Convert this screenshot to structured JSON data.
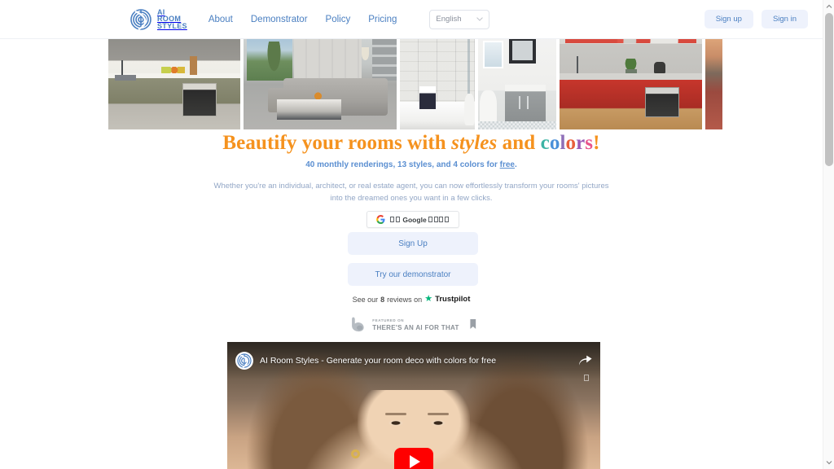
{
  "header": {
    "logo": {
      "icon": "spiral-logo-icon",
      "line1": "AI",
      "line2": "ROOM",
      "line3": "STYLES"
    },
    "nav": [
      {
        "label": "About"
      },
      {
        "label": "Demonstrator"
      },
      {
        "label": "Policy"
      },
      {
        "label": "Pricing"
      }
    ],
    "language": {
      "selected": "English",
      "icon": "chevron-down-icon"
    },
    "signup_label": "Sign up",
    "signin_label": "Sign in"
  },
  "hero": {
    "images": [
      {
        "alt": "olive-green-kitchen"
      },
      {
        "alt": "grey-living-room"
      },
      {
        "alt": "white-tiled-bathroom"
      },
      {
        "alt": "grey-bathroom-vanity"
      },
      {
        "alt": "red-kitchen"
      },
      {
        "alt": "warm-toned-room"
      }
    ],
    "headline": {
      "part1": "Beautify your rooms with ",
      "styles": "styles",
      "part2": " and ",
      "colors_letters": [
        "c",
        "o",
        "l",
        "o",
        "r",
        "s"
      ],
      "bang": "!"
    },
    "subline": {
      "before": "40 monthly renderings, 13 styles, and 4 colors for ",
      "link": "free",
      "after": "."
    },
    "description_line1": "Whether you're an individual, architect, or real estate agent, you can now effortlessly transform your rooms' pictures",
    "description_line2": "into the dreamed ones you want in a few clicks."
  },
  "cta": {
    "google_label": "□□ Google □□□□",
    "google_icon": "google-g-icon",
    "signup_label": "Sign Up",
    "demonstrator_label": "Try our demonstrator"
  },
  "trustpilot": {
    "prefix": "See our",
    "count": "8",
    "middle": "reviews on",
    "star_icon": "trustpilot-star-icon",
    "name": "Trustpilot"
  },
  "taaft": {
    "icon": "flexed-arm-icon",
    "small": "FEATURED ON",
    "large": "THERE'S AN AI FOR THAT",
    "bookmark_icon": "bookmark-icon"
  },
  "video": {
    "title": "AI Room Styles - Generate your room deco with colors for free",
    "avatar_icon": "channel-avatar-icon",
    "share_icon": "share-icon",
    "more_icon": "more-options-icon",
    "play_icon": "youtube-play-button"
  },
  "scrollbar": {
    "up_icon": "scroll-up-arrow-icon",
    "down_icon": "scroll-down-arrow-icon",
    "thumb": "scrollbar-thumb"
  },
  "colors": {
    "brand_blue": "#4a7fc1",
    "headline_orange": "#f5921e",
    "letter_c": "#3bb3a4",
    "letter_o1": "#4a90d9",
    "letter_l": "#8f6fb8",
    "letter_o2": "#e8603c",
    "letter_r": "#9b59b6",
    "letter_s": "#e8548c",
    "letter_bang": "#f5921e",
    "trustpilot_green": "#00b67a",
    "youtube_red": "#ff0000",
    "button_bg": "#eef2fc"
  }
}
